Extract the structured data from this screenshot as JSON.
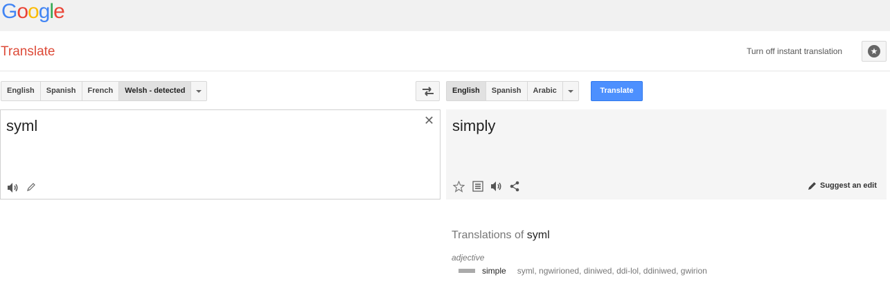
{
  "logo": {
    "parts": [
      "G",
      "o",
      "o",
      "g",
      "l",
      "e"
    ]
  },
  "header": {
    "title": "Translate",
    "instant_link": "Turn off instant translation"
  },
  "source": {
    "languages": [
      "English",
      "Spanish",
      "French",
      "Welsh - detected"
    ],
    "active_language": "Welsh - detected",
    "text": "syml"
  },
  "target": {
    "languages": [
      "English",
      "Spanish",
      "Arabic"
    ],
    "active_language": "English",
    "translate_button": "Translate",
    "text": "simply",
    "suggest_edit": "Suggest an edit"
  },
  "dictionary": {
    "heading_prefix": "Translations of",
    "heading_word": "syml",
    "part_of_speech": "adjective",
    "entries": [
      {
        "word": "simple",
        "synonyms": "syml, ngwirioned, diniwed, ddi-lol, ddiniwed, gwirion"
      }
    ]
  },
  "colors": {
    "title_red": "#dd4b39",
    "translate_blue": "#4d90fe",
    "topbar_bg": "#f1f1f1"
  },
  "icons": [
    "star-icon",
    "swap-icon",
    "close-icon",
    "speaker-icon",
    "pencil-icon",
    "phrasebook-star-icon",
    "list-icon",
    "share-icon",
    "edit-pencil-icon",
    "chevron-down-icon"
  ]
}
